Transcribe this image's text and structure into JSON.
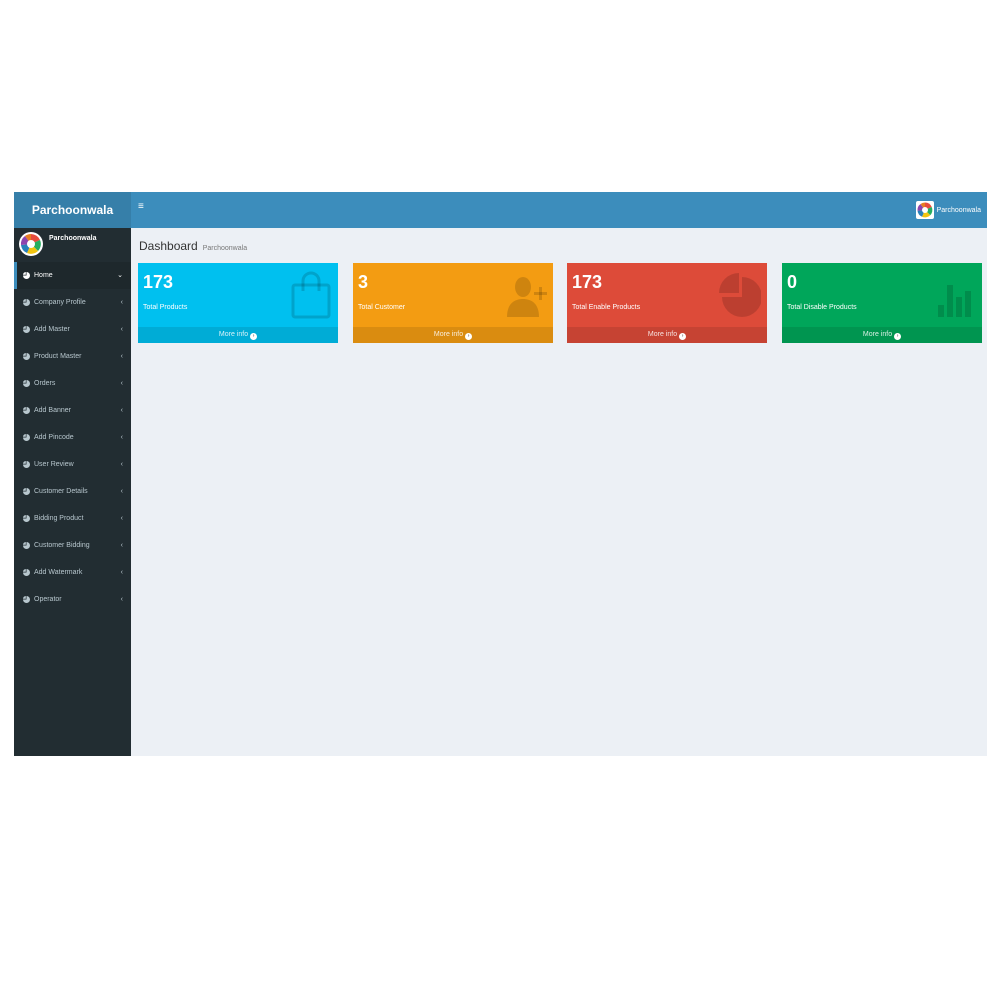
{
  "sidebar": {
    "brand": "Parchoonwala",
    "user_name": "Parchoonwala",
    "items": [
      {
        "label": "Home",
        "chevron": "⌄",
        "active": true
      },
      {
        "label": "Company Profile",
        "chevron": "‹"
      },
      {
        "label": "Add Master",
        "chevron": "‹"
      },
      {
        "label": "Product Master",
        "chevron": "‹"
      },
      {
        "label": "Orders",
        "chevron": "‹"
      },
      {
        "label": "Add Banner",
        "chevron": "‹"
      },
      {
        "label": "Add Pincode",
        "chevron": "‹"
      },
      {
        "label": "User Review",
        "chevron": "‹"
      },
      {
        "label": "Customer Details",
        "chevron": "‹"
      },
      {
        "label": "Bidding Product",
        "chevron": "‹"
      },
      {
        "label": "Customer Bidding",
        "chevron": "‹"
      },
      {
        "label": "Add Watermark",
        "chevron": "‹"
      },
      {
        "label": "Operator",
        "chevron": "‹"
      }
    ]
  },
  "header": {
    "menu_toggle": "≡",
    "user_name": "Parchoonwala"
  },
  "page": {
    "title": "Dashboard",
    "subtitle": "Parchoonwala"
  },
  "stats": [
    {
      "value": "173",
      "label": "Total Products",
      "footer": "More info",
      "icon": "shopping-bag-icon",
      "color": "#00c0ef"
    },
    {
      "value": "3",
      "label": "Total Customer",
      "footer": "More info",
      "icon": "user-add-icon",
      "color": "#f39c12"
    },
    {
      "value": "173",
      "label": "Total Enable Products",
      "footer": "More info",
      "icon": "pie-chart-icon",
      "color": "#dd4b39"
    },
    {
      "value": "0",
      "label": "Total Disable Products",
      "footer": "More info",
      "icon": "bar-chart-icon",
      "color": "#00a65a"
    }
  ],
  "colors": {
    "sidebar_bg": "#222d32",
    "header_bg": "#3c8dbc",
    "brand_bg": "#367fa9",
    "content_bg": "#ecf0f5"
  }
}
